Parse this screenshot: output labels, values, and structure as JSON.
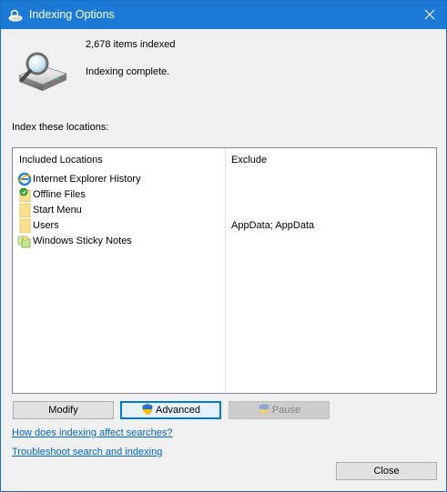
{
  "window": {
    "title": "Indexing Options",
    "app_icon": "indexing-options-icon",
    "close_icon": "close-icon"
  },
  "status": {
    "items_indexed": "2,678 items indexed",
    "state": "Indexing complete."
  },
  "index_label": "Index these locations:",
  "locations": {
    "headers": {
      "included": "Included Locations",
      "exclude": "Exclude"
    },
    "rows": [
      {
        "name": "Internet Explorer History",
        "exclude": "",
        "icon": "internet-explorer-icon"
      },
      {
        "name": "Offline Files",
        "exclude": "",
        "icon": "offline-files-icon"
      },
      {
        "name": "Start Menu",
        "exclude": "",
        "icon": "folder-icon"
      },
      {
        "name": "Users",
        "exclude": "AppData; AppData",
        "icon": "folder-icon"
      },
      {
        "name": "Windows Sticky Notes",
        "exclude": "",
        "icon": "sticky-notes-icon"
      }
    ]
  },
  "buttons": {
    "modify": "Modify",
    "advanced": "Advanced",
    "pause": "Pause",
    "close": "Close"
  },
  "links": {
    "how_indexing": "How does indexing affect searches?",
    "troubleshoot": "Troubleshoot search and indexing"
  },
  "colors": {
    "titlebar": "#1c7ad6",
    "link": "#0066cc",
    "focus": "#0078d7"
  }
}
